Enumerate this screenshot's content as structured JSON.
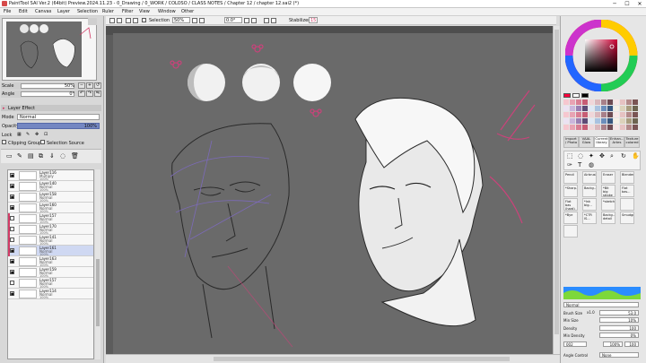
{
  "window": {
    "title": "PaintTool SAI Ver.2 (64bit) Preview.2024.11.23 - 0_Drawing / 0_WORK / COLOSO / CLASS NOTES / Chapter 12 / chapter 12.sai2 (*)",
    "minimize": "─",
    "maximize": "☐",
    "close": "✕"
  },
  "menu": [
    "File",
    "Edit",
    "Canvas",
    "Layer",
    "Selection",
    "Ruler",
    "Filter",
    "View",
    "Window",
    "Other"
  ],
  "toolbar": {
    "selection_label": "Selection",
    "zoom": "50%",
    "rotation": "0.0°",
    "stabilizer_label": "Stabilizer",
    "stabilizer_value": "15"
  },
  "navigator": {
    "scale_label": "Scale",
    "scale_value": "50%",
    "angle_label": "Angle",
    "angle_value": "0°"
  },
  "layer_panel": {
    "effect_label": "Layer Effect",
    "mode_label": "Mode",
    "mode_value": "Normal",
    "opacity_label": "Opacity",
    "opacity_value": "100%",
    "lock_label": "Lock",
    "clipping_label": "Clipping Group",
    "selection_source_label": "Selection Source",
    "layers": [
      {
        "name": "Layer116",
        "mode": "Multiply",
        "opacity": "100%",
        "visible": true,
        "clipped": false,
        "selected": false
      },
      {
        "name": "Layer140",
        "mode": "Normal",
        "opacity": "100%",
        "visible": true,
        "clipped": false,
        "selected": false
      },
      {
        "name": "Layer158",
        "mode": "Normal",
        "opacity": "100%",
        "visible": true,
        "clipped": false,
        "selected": false
      },
      {
        "name": "Layer160",
        "mode": "Normal",
        "opacity": "100%",
        "visible": true,
        "clipped": false,
        "selected": false
      },
      {
        "name": "Layer157",
        "mode": "Normal",
        "opacity": "100%",
        "visible": false,
        "clipped": true,
        "selected": false
      },
      {
        "name": "Layer170",
        "mode": "Normal",
        "opacity": "100%",
        "visible": false,
        "clipped": true,
        "selected": false
      },
      {
        "name": "Layer141",
        "mode": "Normal",
        "opacity": "100%",
        "visible": false,
        "clipped": true,
        "selected": false
      },
      {
        "name": "Layer161",
        "mode": "Normal",
        "opacity": "100%",
        "visible": true,
        "clipped": true,
        "selected": true
      },
      {
        "name": "Layer163",
        "mode": "Normal",
        "opacity": "100%",
        "visible": true,
        "clipped": false,
        "selected": false
      },
      {
        "name": "Layer159",
        "mode": "Normal",
        "opacity": "100%",
        "visible": true,
        "clipped": false,
        "selected": false
      },
      {
        "name": "Layer157",
        "mode": "Normal",
        "opacity": "100%",
        "visible": false,
        "clipped": false,
        "selected": false
      },
      {
        "name": "Layer114",
        "mode": "Normal",
        "opacity": "100%",
        "visible": true,
        "clipped": false,
        "selected": false
      }
    ]
  },
  "right_panel": {
    "tabs": [
      {
        "label": "Import / Photo",
        "active": false
      },
      {
        "label": "VAAL Glow",
        "active": false
      },
      {
        "label": "Current library",
        "active": true
      },
      {
        "label": "Enhan... Artes",
        "active": false
      },
      {
        "label": "Texture colored",
        "active": false
      }
    ],
    "tools": [
      "Pencil",
      "Airbrush",
      "Eraser",
      "Blender",
      "*Sharp...",
      "Backg...",
      "*Bit big stroke",
      "Flat bas...",
      "Flat bas (hard)",
      "*Ink big...",
      "*sketch",
      "",
      "*Bye",
      "*CTR IS...",
      "Backg... detail",
      "Smudge",
      ""
    ],
    "blend_mode": "Normal",
    "brush_size_label": "Brush Size",
    "brush_size_mult": "x1.0",
    "brush_size_value": "53.0",
    "min_size_label": "Min Size",
    "min_size_value": "10%",
    "density_label": "Density",
    "density_value": "100",
    "min_density_label": "Min Density",
    "min_density_value": "0%",
    "texture_value": "002",
    "texture_scale": "100%",
    "texture_strength": "100",
    "angle_control_label": "Angle Control",
    "angle_control_value": "None"
  },
  "colors": {
    "accent_pink": "#d23b66",
    "selected_layer": "#cfd8f2",
    "canvas_bg": "#6a6a6a"
  }
}
